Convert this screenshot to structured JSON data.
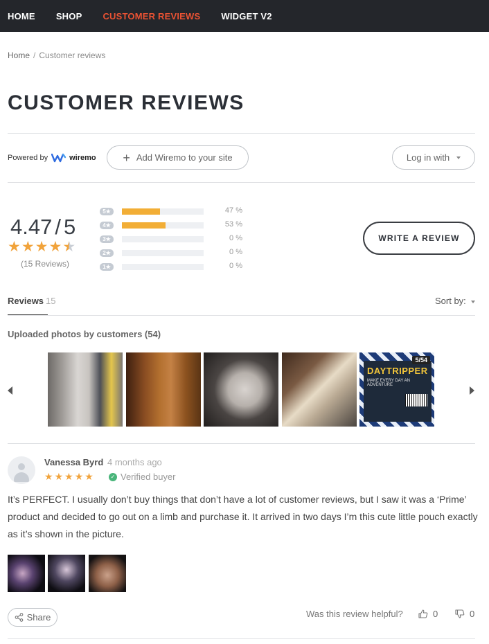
{
  "nav": {
    "items": [
      "HOME",
      "SHOP",
      "CUSTOMER REVIEWS",
      "WIDGET V2"
    ],
    "active": "CUSTOMER REVIEWS",
    "accent": "#ea5233"
  },
  "breadcrumb": {
    "home": "Home",
    "sep": "/",
    "current": "Customer reviews"
  },
  "page": {
    "title": "CUSTOMER REVIEWS"
  },
  "widget": {
    "powered_by": "Powered by",
    "brand": "wiremo",
    "add_site": "Add Wiremo to your site",
    "login": "Log in with"
  },
  "summary": {
    "average": "4.47",
    "out_of": "5",
    "rating_value": 4.47,
    "reviews_label": "(15 Reviews)",
    "star_color": "#f1a33b",
    "bars": [
      {
        "stars": "5",
        "percent": "47 %",
        "fraction": 0.47
      },
      {
        "stars": "4",
        "percent": "53 %",
        "fraction": 0.53
      },
      {
        "stars": "3",
        "percent": "0 %",
        "fraction": 0
      },
      {
        "stars": "2",
        "percent": "0 %",
        "fraction": 0
      },
      {
        "stars": "1",
        "percent": "0 %",
        "fraction": 0
      }
    ],
    "write_review": "WRITE A REVIEW"
  },
  "tabs": {
    "reviews_label": "Reviews",
    "reviews_count": "15",
    "sort_label": "Sort by:"
  },
  "uploads": {
    "title": "Uploaded photos by customers (54)",
    "last_photo_counter": "5/54",
    "last_photo_text": {
      "headline": "DAYTRIPPER",
      "sub": "MAKE EVERY DAY AN ADVENTURE"
    }
  },
  "review": {
    "author": "Vanessa Byrd",
    "date": "4 months ago",
    "rating": 5,
    "verified": "Verified buyer",
    "text": "It’s PERFECT. I usually don’t buy things that don’t have a lot of customer reviews, but I saw it was a ‘Prime’ product and decided to go out on a limb and purchase it. It arrived in two days I’m this cute little pouch exactly as it’s shown in the picture.",
    "share": "Share",
    "helpful_label": "Was this review helpful?",
    "up_count": "0",
    "down_count": "0"
  }
}
